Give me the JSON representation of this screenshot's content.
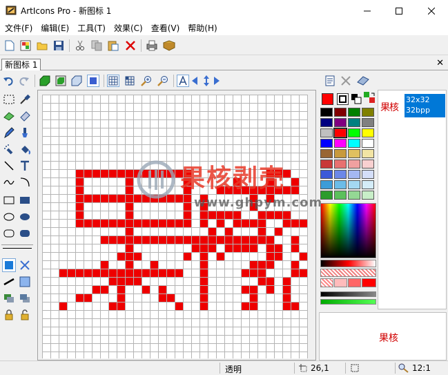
{
  "window": {
    "title": "ArtIcons Pro - 新图标 1"
  },
  "menu": [
    "文件(F)",
    "编辑(E)",
    "工具(T)",
    "效果(C)",
    "查看(V)",
    "帮助(H)"
  ],
  "tabs": {
    "active": "新图标 1"
  },
  "image_list": {
    "char": "果",
    "char2": "核",
    "size": "32x32",
    "depth": "32bpp"
  },
  "preview": {
    "text": "果核"
  },
  "watermark": {
    "text": "果核剥壳",
    "url": "www.ghpym.com"
  },
  "status": {
    "mode": "透明",
    "coord": "26,1",
    "zoom": "12:1"
  },
  "colors": {
    "pixel": "#ee0000",
    "selection": "#0078d7",
    "primary": "#ff0000",
    "swatches": [
      [
        "#000000",
        "#800000",
        "#008000",
        "#808000"
      ],
      [
        "#000080",
        "#800080",
        "#008080",
        "#808080"
      ],
      [
        "#c0c0c0",
        "#ff0000",
        "#00ff00",
        "#ffff00"
      ],
      [
        "#0000ff",
        "#ff00ff",
        "#00ffff",
        "#ffffff"
      ],
      [
        "#996633",
        "#c89a3c",
        "#e0c060",
        "#f2e4a4"
      ],
      [
        "#c83838",
        "#e87070",
        "#f0a0a0",
        "#f8d0d0"
      ],
      [
        "#3c5ad8",
        "#6c88e8",
        "#a4b8f2",
        "#d4def8"
      ],
      [
        "#3c9cd8",
        "#6cbce8",
        "#a4d8f2",
        "#d4ecf8"
      ],
      [
        "#2c9c2c",
        "#5cc05c",
        "#94d894",
        "#c8eec8"
      ]
    ]
  },
  "pixels": [
    "................................",
    "................................",
    "................................",
    "................................",
    "................................",
    "................................",
    "................................",
    "................................",
    "................................",
    "....XXXXXXXXXXXXXX.........XXX..",
    "....X.....X......X.....X...X..X.",
    "....X.....X......X...XXXXXXXXXX.",
    "....XXXXXXXXXXXXXX.X.....X.X....",
    "....X.....X......X.X.....X......",
    "....X.....X......X.XXXXX..XXXX..",
    "....XXXXXXXXXXXXXX.X.X.XXXX..XXX",
    "..........X.........X.X...X.X...",
    ".......XXXXXXXXXXXXXXXXXXXXX..X.",
    "..........X.......XXX.XXXX.XX.X.",
    ".........XXX.....X.X.X.....XX..X",
    ".......X..X..X.....X.....XXX..X.",
    "..XXXXXXXXXXXXXXX..X....XXX...XX",
    "........XXXX.......X......XX.X..",
    "......XX.X..X.X....X....XX.X.X..",
    "....XX...X....XX...X.....X...X..",
    "..X.....XX......X..X....XX...XX."
  ]
}
